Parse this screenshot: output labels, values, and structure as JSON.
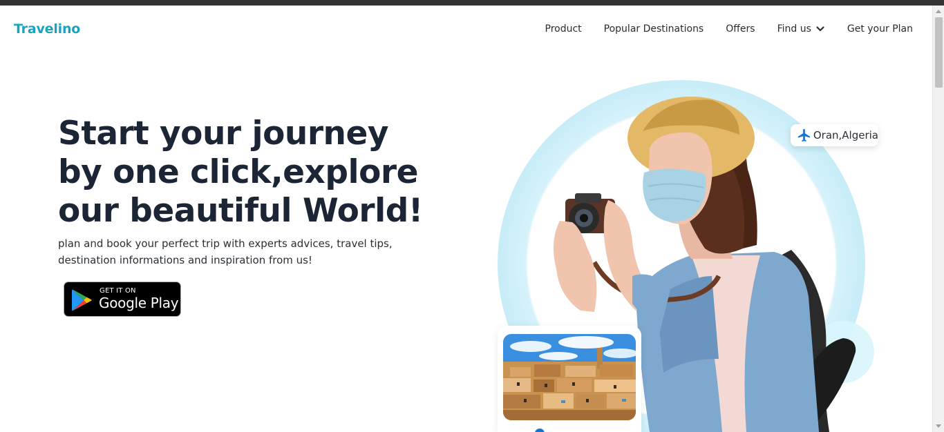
{
  "brand": {
    "name": "Travelino",
    "color": "#1aa3bd"
  },
  "nav": {
    "items": [
      {
        "label": "Product"
      },
      {
        "label": "Popular Destinations"
      },
      {
        "label": "Offers"
      },
      {
        "label": "Find us",
        "icon": "chevron-down-icon"
      },
      {
        "label": "Get your Plan"
      }
    ]
  },
  "hero": {
    "title_lines": [
      "Start your journey",
      "by one click,explore",
      "our beautiful World!"
    ],
    "subtitle": "plan and book your perfect trip with experts advices, travel tips, destination informations and inspiration from us!"
  },
  "google_play": {
    "small": "GET IT ON",
    "big": "Google Play"
  },
  "location_badge": {
    "icon": "airplane-icon",
    "text": "Oran,Algeria"
  },
  "colors": {
    "accent": "#1aa3bd",
    "heading": "#1b2535",
    "ring": "#b9e8f6",
    "plane": "#1a73c8"
  }
}
